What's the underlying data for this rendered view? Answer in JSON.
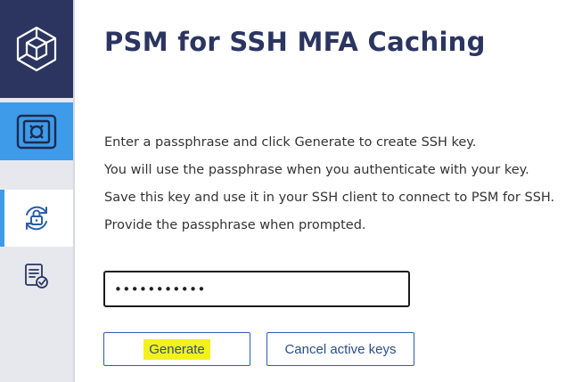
{
  "page": {
    "title": "PSM for SSH MFA Caching",
    "instructions": [
      "Enter a passphrase and click Generate to create SSH key.",
      "You will use the passphrase when you authenticate with your key.",
      "Save this key and use it in your SSH client to connect to PSM for SSH.",
      "Provide the passphrase when prompted."
    ]
  },
  "form": {
    "passphrase_value": "•••••••••••"
  },
  "buttons": {
    "generate_label": "Generate",
    "cancel_label": "Cancel active keys"
  },
  "sidebar": {
    "items": [
      {
        "icon": "vault-icon",
        "active": false
      },
      {
        "icon": "lock-refresh-icon",
        "active": true
      },
      {
        "icon": "certificate-icon",
        "active": false
      }
    ]
  },
  "colors": {
    "navy": "#2b3560",
    "accent_blue": "#3d9be9",
    "sidebar_bg": "#e6e8ee",
    "highlight": "#f3f11c"
  }
}
